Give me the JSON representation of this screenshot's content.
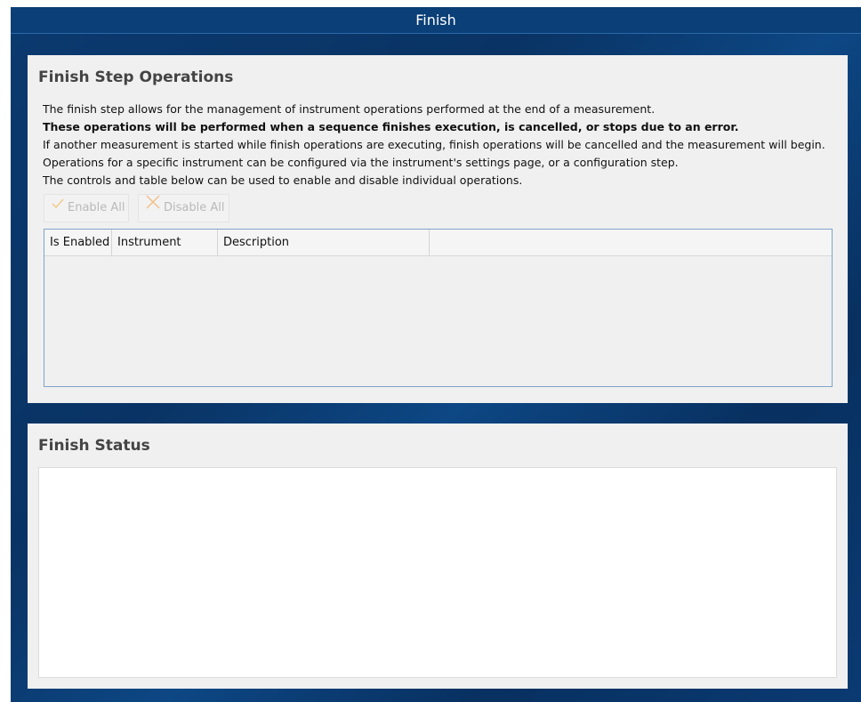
{
  "window": {
    "title": "Finish"
  },
  "operations_panel": {
    "heading": "Finish Step Operations",
    "description_lines": [
      "The finish step allows for the management of instrument operations performed at the end of a measurement.",
      "These operations will be performed when a sequence finishes execution, is cancelled, or stops due to an error.",
      "If another measurement is started while finish operations are executing, finish operations will be cancelled and the measurement will begin.",
      "Operations for a specific instrument can be configured via the instrument's settings page, or a configuration step.",
      "The controls and table below can be used to enable and disable individual operations."
    ],
    "enable_all_label": "Enable All",
    "disable_all_label": "Disable All",
    "enable_icon": "checkmark-icon",
    "disable_icon": "x-icon",
    "table": {
      "columns": [
        "Is Enabled",
        "Instrument",
        "Description"
      ],
      "rows": []
    }
  },
  "status_panel": {
    "heading": "Finish Status",
    "content": ""
  },
  "colors": {
    "background": "#0b3a70",
    "panel": "#f0f0f0",
    "disabled_text": "#b9b9b9",
    "check_icon": "#f2c98c",
    "x_icon": "#f2c08a"
  }
}
